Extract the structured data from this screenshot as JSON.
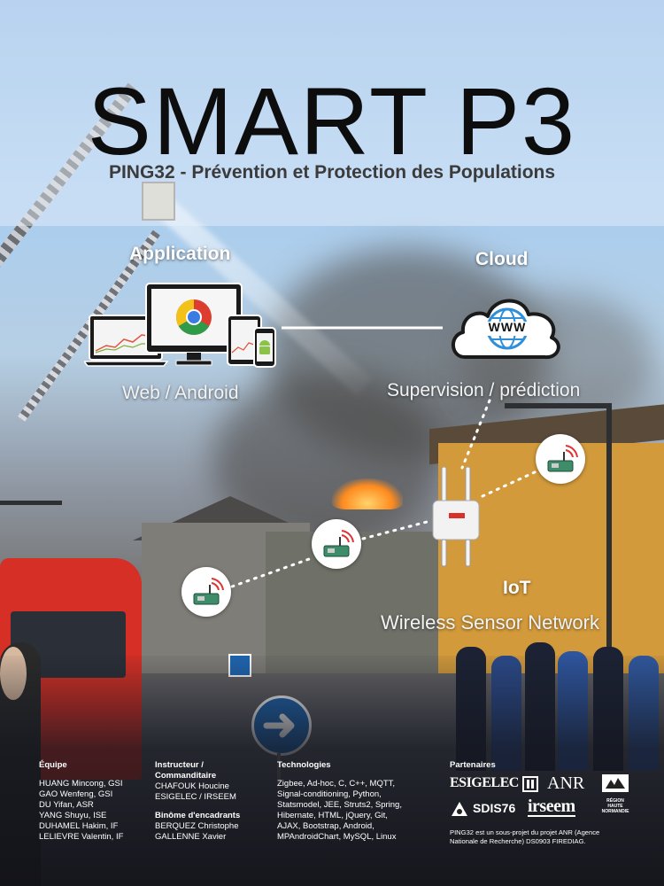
{
  "header": {
    "title": "SMART P3",
    "subtitle": "PING32 - Prévention et Protection des Populations"
  },
  "diagram": {
    "application": {
      "heading": "Application",
      "caption": "Web / Android"
    },
    "cloud": {
      "heading": "Cloud",
      "caption": "Supervision / prédiction",
      "icon_text": "WWW"
    },
    "iot": {
      "heading": "IoT",
      "caption": "Wireless Sensor Network"
    }
  },
  "footer": {
    "equipe": {
      "heading": "Équipe",
      "members": [
        "HUANG Mincong, GSI",
        "GAO Wenfeng, GSI",
        "DU Yifan, ASR",
        "YANG Shuyu, ISE",
        "DUHAMEL Hakim, IF",
        "LELIEVRE Valentin, IF"
      ]
    },
    "instructeur": {
      "heading_line1": "Instructeur /",
      "heading_line2": "Commanditaire",
      "lines": [
        "CHAFOUK Houcine",
        "ESIGELEC / IRSEEM"
      ],
      "binome_heading": "Binôme d'encadrants",
      "binome_lines": [
        "BERQUEZ Christophe",
        "GALLENNE Xavier"
      ]
    },
    "technologies": {
      "heading": "Technologies",
      "lines": [
        "Zigbee, Ad-hoc, C, C++, MQTT,",
        "Signal-conditioning, Python,",
        "Statsmodel, JEE, Struts2, Spring,",
        "Hibernate, HTML, jQuery, Git,",
        "AJAX, Bootstrap, Android,",
        "MPAndroidChart, MySQL, Linux"
      ]
    },
    "partenaires": {
      "heading": "Partenaires",
      "logos": {
        "esigelec": "ESIGELEC",
        "anr": "ANR",
        "region": "RÉGION HAUTE NORMANDIE",
        "sdis": "SDIS76",
        "irseem": "irseem"
      },
      "note_lines": [
        "PING32 est un sous-projet du projet ANR (Agence",
        "Nationale de Recherche) DS0903 FIREDIAG."
      ]
    }
  }
}
